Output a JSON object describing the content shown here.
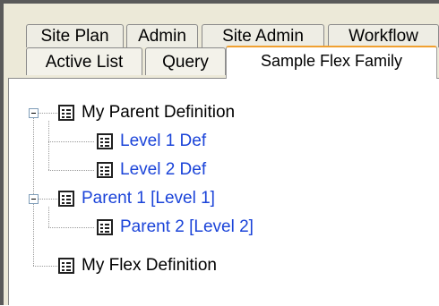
{
  "tabs": {
    "row1": [
      {
        "label": "Site Plan"
      },
      {
        "label": "Admin"
      },
      {
        "label": "Site Admin"
      },
      {
        "label": "Workflow"
      }
    ],
    "row2": [
      {
        "label": "Active List"
      },
      {
        "label": "Query"
      },
      {
        "label": "Sample Flex Family",
        "active": true
      }
    ]
  },
  "tree": {
    "nodes": [
      {
        "label": "My Parent Definition",
        "style": "parent",
        "expanded": true
      },
      {
        "label": "Level 1 Def",
        "style": "link"
      },
      {
        "label": "Level 2 Def",
        "style": "link"
      },
      {
        "label": "Parent 1 [Level 1]",
        "style": "link",
        "expanded": true
      },
      {
        "label": "Parent 2 [Level 2]",
        "style": "link"
      },
      {
        "label": "My Flex Definition",
        "style": "parent"
      }
    ]
  },
  "colors": {
    "link": "#1b44d9",
    "active_tab_accent": "#f0a030"
  },
  "icons": {
    "toggle": "minus-box-icon",
    "definition": "form-definition-icon"
  }
}
